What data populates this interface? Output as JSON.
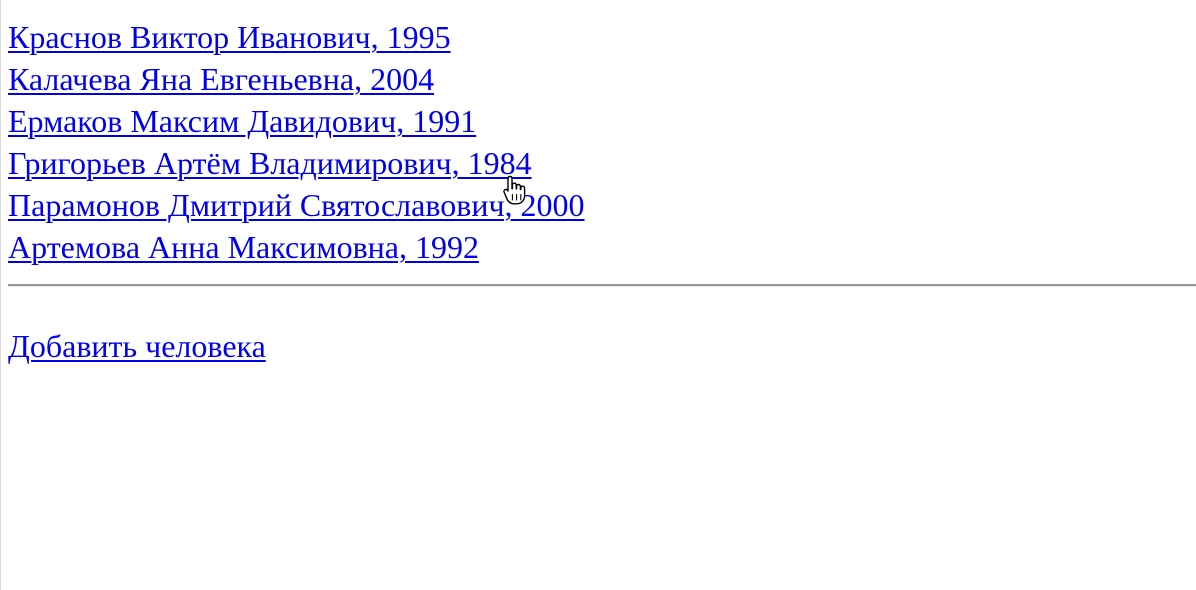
{
  "people": [
    {
      "label": "Краснов Виктор Иванович, 1995"
    },
    {
      "label": "Калачева Яна Евгеньевна, 2004"
    },
    {
      "label": "Ермаков Максим Давидович, 1991"
    },
    {
      "label": "Григорьев Артём Владимирович, 1984"
    },
    {
      "label": "Парамонов Дмитрий Святославович, 2000"
    },
    {
      "label": "Артемова Анна Максимовна, 1992"
    }
  ],
  "actions": {
    "add_person_label": "Добавить человека"
  },
  "colors": {
    "link": "#0000ee",
    "rule": "#9a9a9a",
    "background": "#ffffff"
  },
  "icons": {
    "cursor": "hand-pointer-cursor-icon"
  }
}
